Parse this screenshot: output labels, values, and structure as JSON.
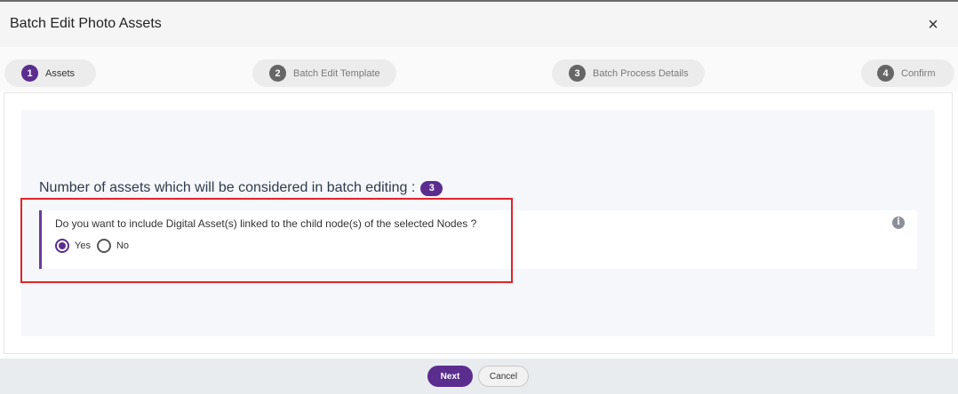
{
  "dialog": {
    "title": "Batch Edit Photo Assets",
    "close_icon": "close-icon",
    "close_glyph": "×"
  },
  "steps": [
    {
      "number": "1",
      "label": "Assets",
      "active": true
    },
    {
      "number": "2",
      "label": "Batch Edit Template",
      "active": false
    },
    {
      "number": "3",
      "label": "Batch Process Details",
      "active": false
    },
    {
      "number": "4",
      "label": "Confirm",
      "active": false
    }
  ],
  "summary": {
    "label": "Number of assets which will be considered in batch editing :",
    "count": "3"
  },
  "question": {
    "text": "Do you want to include Digital Asset(s) linked to the child node(s) of the selected Nodes ?",
    "options": [
      {
        "label": "Yes",
        "selected": true
      },
      {
        "label": "No",
        "selected": false
      }
    ],
    "info_icon": "info-icon",
    "info_glyph": "i"
  },
  "footer": {
    "next_label": "Next",
    "cancel_label": "Cancel"
  },
  "colors": {
    "accent": "#5b2d8e",
    "highlight": "#e0242a"
  }
}
